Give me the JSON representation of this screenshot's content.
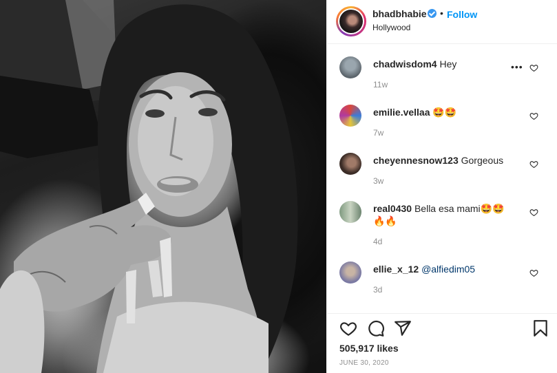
{
  "post": {
    "image_alt": "Black and white selfie photo",
    "owner": {
      "username": "bhadbhabie",
      "verified": true,
      "follow_label": "Follow",
      "location": "Hollywood"
    },
    "separator": "•"
  },
  "comments": [
    {
      "username": "chadwisdom4",
      "text": "Hey",
      "time": "11w",
      "avatar_color": "#7d8a93"
    },
    {
      "username": "emilie.vellaa",
      "text": "🤩🤩",
      "time": "7w",
      "avatar_color": "#c64a6a"
    },
    {
      "username": "cheyennesnow123",
      "text": "Gorgeous",
      "time": "3w",
      "avatar_color": "#4a3a33"
    },
    {
      "username": "real0430",
      "text": "Bella esa mami🤩🤩🔥🔥",
      "time": "4d",
      "avatar_color": "#8fa38f"
    },
    {
      "username": "ellie_x_12",
      "text": "",
      "mention": "@alfiedim05",
      "time": "3d",
      "avatar_color": "#8c7fa8"
    }
  ],
  "footer": {
    "likes": "505,917 likes",
    "date": "JUNE 30, 2020"
  },
  "icons": {
    "like": "heart-icon",
    "comment": "comment-icon",
    "share": "share-icon",
    "save": "bookmark-icon",
    "comment_like": "heart-outline-icon",
    "more": "more-options-icon"
  },
  "colors": {
    "accent": "#0095f6",
    "verified": "#3897f0",
    "muted": "#8e8e8e",
    "text": "#262626"
  }
}
